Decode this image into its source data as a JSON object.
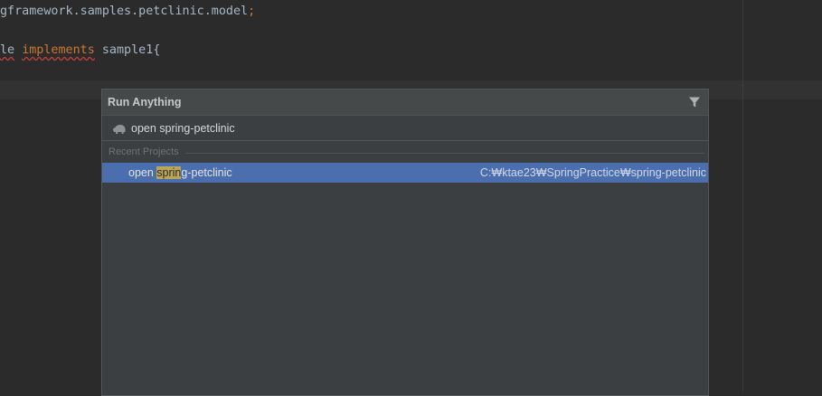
{
  "editor": {
    "line1": {
      "text": "gframework.samples.petclinic.model",
      "semicolon": ";"
    },
    "line2": {
      "prefix": "le",
      "keyword": "implements",
      "rest": "sample1{"
    }
  },
  "popup": {
    "title": "Run Anything",
    "filter_icon": "filter-icon",
    "run_icon": "run-anything-icon",
    "search": {
      "value": "open spring-petclinic",
      "placeholder": ""
    },
    "section_label": "Recent Projects",
    "results": [
      {
        "name_before": "open ",
        "name_match": "sprin",
        "name_after": "g-petclinic",
        "path": "C:₩ktae23₩SpringPractice₩spring-petclinic",
        "selected": true
      }
    ]
  },
  "colors": {
    "editor_bg": "#2b2b2b",
    "popup_bg": "#3c3f41",
    "selection": "#4b6eaf",
    "match_highlight": "#bba557",
    "keyword": "#cc7832",
    "code_text": "#a9b7c6"
  }
}
